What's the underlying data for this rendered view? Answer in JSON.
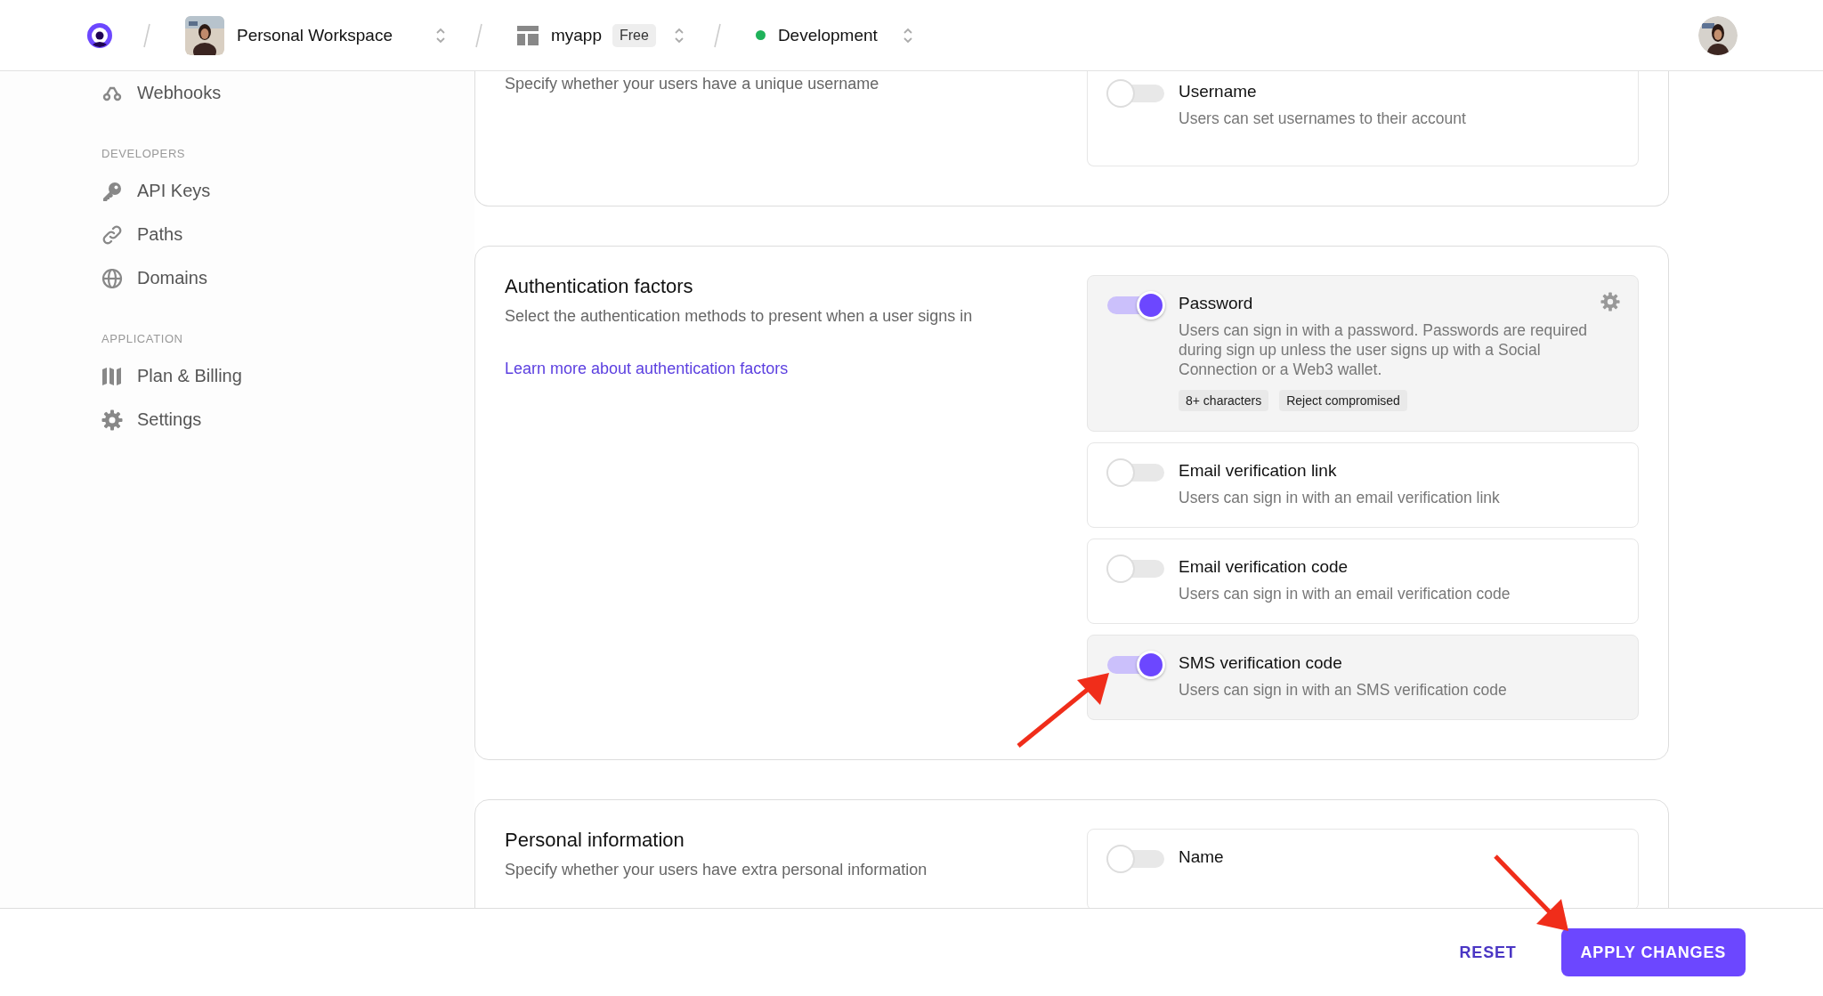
{
  "header": {
    "workspace": "Personal Workspace",
    "app": {
      "name": "myapp",
      "badge": "Free"
    },
    "environment": {
      "name": "Development",
      "color": "#1fb25a"
    }
  },
  "sidebar": {
    "sections": [
      {
        "items": [
          {
            "label": "Webhooks"
          }
        ]
      },
      {
        "label": "DEVELOPERS",
        "items": [
          {
            "label": "API Keys"
          },
          {
            "label": "Paths"
          },
          {
            "label": "Domains"
          }
        ]
      },
      {
        "label": "APPLICATION",
        "items": [
          {
            "label": "Plan & Billing"
          },
          {
            "label": "Settings"
          }
        ]
      }
    ]
  },
  "cards": [
    {
      "description": "Specify whether your users have a unique username",
      "options": [
        {
          "title": "Username",
          "description": "Users can set usernames to their account",
          "on": false
        }
      ]
    },
    {
      "title": "Authentication factors",
      "description": "Select the authentication methods to present when a user signs in",
      "link": "Learn more about authentication factors",
      "options": [
        {
          "title": "Password",
          "description": "Users can sign in with a password. Passwords are required during sign up unless the user signs up with a Social Connection or a Web3 wallet.",
          "on": true,
          "settings": true,
          "tags": [
            "8+ characters",
            "Reject compromised"
          ]
        },
        {
          "title": "Email verification link",
          "description": "Users can sign in with an email verification link",
          "on": false
        },
        {
          "title": "Email verification code",
          "description": "Users can sign in with an email verification code",
          "on": false
        },
        {
          "title": "SMS verification code",
          "description": "Users can sign in with an SMS verification code",
          "on": true
        }
      ]
    },
    {
      "title": "Personal information",
      "description": "Specify whether your users have extra personal information",
      "options": [
        {
          "title": "Name",
          "on": false
        }
      ]
    }
  ],
  "footer": {
    "reset": "RESET",
    "apply": "APPLY CHANGES"
  }
}
